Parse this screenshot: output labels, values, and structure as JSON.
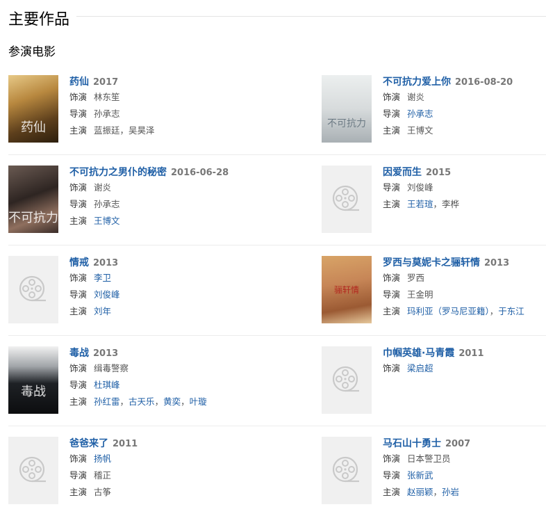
{
  "page_title": "主要作品",
  "section_title": "参演电影",
  "films": [
    {
      "title": "药仙",
      "year": "2017",
      "poster_text": "药仙",
      "roles": [
        {
          "label": "饰演",
          "names": [
            {
              "text": "林东笙",
              "link": false
            }
          ]
        },
        {
          "label": "导演",
          "names": [
            {
              "text": "孙承志",
              "link": false
            }
          ]
        },
        {
          "label": "主演",
          "names": [
            {
              "text": "蓝振廷",
              "link": false
            },
            {
              "text": "吴昊泽",
              "link": false
            }
          ]
        }
      ]
    },
    {
      "title": "不可抗力爱上你",
      "year": "2016-08-20",
      "poster_text": "不可抗力",
      "roles": [
        {
          "label": "饰演",
          "names": [
            {
              "text": "谢炎",
              "link": false
            }
          ]
        },
        {
          "label": "导演",
          "names": [
            {
              "text": "孙承志",
              "link": true
            }
          ]
        },
        {
          "label": "主演",
          "names": [
            {
              "text": "王博文",
              "link": false
            }
          ]
        }
      ]
    },
    {
      "title": "不可抗力之男仆的秘密",
      "year": "2016-06-28",
      "poster_text": "不可抗力",
      "roles": [
        {
          "label": "饰演",
          "names": [
            {
              "text": "谢炎",
              "link": false
            }
          ]
        },
        {
          "label": "导演",
          "names": [
            {
              "text": "孙承志",
              "link": false
            }
          ]
        },
        {
          "label": "主演",
          "names": [
            {
              "text": "王博文",
              "link": true
            }
          ]
        }
      ]
    },
    {
      "title": "因爱而生",
      "year": "2015",
      "poster_text": "",
      "roles": [
        {
          "label": "导演",
          "names": [
            {
              "text": "刘俊峰",
              "link": false
            }
          ]
        },
        {
          "label": "主演",
          "names": [
            {
              "text": "王若瑄",
              "link": true
            },
            {
              "text": "李桦",
              "link": false
            }
          ]
        }
      ]
    },
    {
      "title": "情戒",
      "year": "2013",
      "poster_text": "",
      "roles": [
        {
          "label": "饰演",
          "names": [
            {
              "text": "李卫",
              "link": true
            }
          ]
        },
        {
          "label": "导演",
          "names": [
            {
              "text": "刘俊峰",
              "link": true
            }
          ]
        },
        {
          "label": "主演",
          "names": [
            {
              "text": "刘年",
              "link": true
            }
          ]
        }
      ]
    },
    {
      "title": "罗西与莫妮卡之骊轩情",
      "year": "2013",
      "poster_text": "骊轩情",
      "roles": [
        {
          "label": "饰演",
          "names": [
            {
              "text": "罗西",
              "link": false
            }
          ]
        },
        {
          "label": "导演",
          "names": [
            {
              "text": "王金明",
              "link": false
            }
          ]
        },
        {
          "label": "主演",
          "names": [
            {
              "text": "玛利亚（罗马尼亚籍）",
              "link": true
            },
            {
              "text": "于东江",
              "link": true
            }
          ]
        }
      ]
    },
    {
      "title": "毒战",
      "year": "2013",
      "poster_text": "毒战",
      "roles": [
        {
          "label": "饰演",
          "names": [
            {
              "text": "缉毒警察",
              "link": false
            }
          ]
        },
        {
          "label": "导演",
          "names": [
            {
              "text": "杜琪峰",
              "link": true
            }
          ]
        },
        {
          "label": "主演",
          "names": [
            {
              "text": "孙红雷",
              "link": true
            },
            {
              "text": "古天乐",
              "link": true
            },
            {
              "text": "黄奕",
              "link": true
            },
            {
              "text": "叶璇",
              "link": true
            }
          ]
        }
      ]
    },
    {
      "title": "巾帼英雄·马青霞",
      "year": "2011",
      "poster_text": "",
      "roles": [
        {
          "label": "饰演",
          "names": [
            {
              "text": "梁启超",
              "link": true
            }
          ]
        }
      ]
    },
    {
      "title": "爸爸来了",
      "year": "2011",
      "poster_text": "",
      "roles": [
        {
          "label": "饰演",
          "names": [
            {
              "text": "扬帆",
              "link": true
            }
          ]
        },
        {
          "label": "导演",
          "names": [
            {
              "text": "稽正",
              "link": false
            }
          ]
        },
        {
          "label": "主演",
          "names": [
            {
              "text": "古筝",
              "link": false
            }
          ]
        }
      ]
    },
    {
      "title": "马石山十勇士",
      "year": "2007",
      "poster_text": "",
      "roles": [
        {
          "label": "饰演",
          "names": [
            {
              "text": "日本警卫员",
              "link": false
            }
          ]
        },
        {
          "label": "导演",
          "names": [
            {
              "text": "张新武",
              "link": true
            }
          ]
        },
        {
          "label": "主演",
          "names": [
            {
              "text": "赵丽颖",
              "link": true
            },
            {
              "text": "孙岩",
              "link": true
            }
          ]
        }
      ]
    }
  ]
}
